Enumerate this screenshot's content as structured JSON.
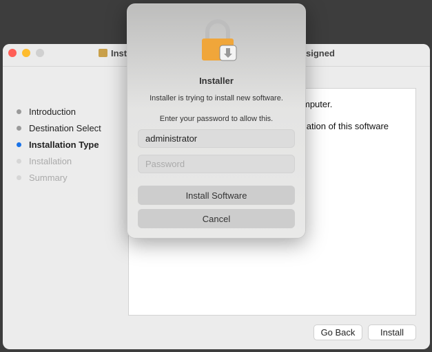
{
  "window": {
    "title_left_fragment": "Inst",
    "title_right_fragment": "signed",
    "steps": [
      {
        "label": "Introduction",
        "state": "done"
      },
      {
        "label": "Destination Select",
        "state": "done"
      },
      {
        "label": "Installation Type",
        "state": "current"
      },
      {
        "label": "Installation",
        "state": "pending"
      },
      {
        "label": "Summary",
        "state": "pending"
      }
    ],
    "content_fragments": [
      "mputer.",
      "llation of this software"
    ],
    "go_back_label": "Go Back",
    "install_label": "Install"
  },
  "dialog": {
    "icon": "lock-installer-icon",
    "title": "Installer",
    "message": "Installer is trying to install new software.",
    "prompt": "Enter your password to allow this.",
    "username_value": "administrator",
    "password_placeholder": "Password",
    "install_button": "Install Software",
    "cancel_button": "Cancel"
  },
  "colors": {
    "accent": "#1a73e8",
    "close": "#ff5f57",
    "minimize": "#febc2e"
  }
}
